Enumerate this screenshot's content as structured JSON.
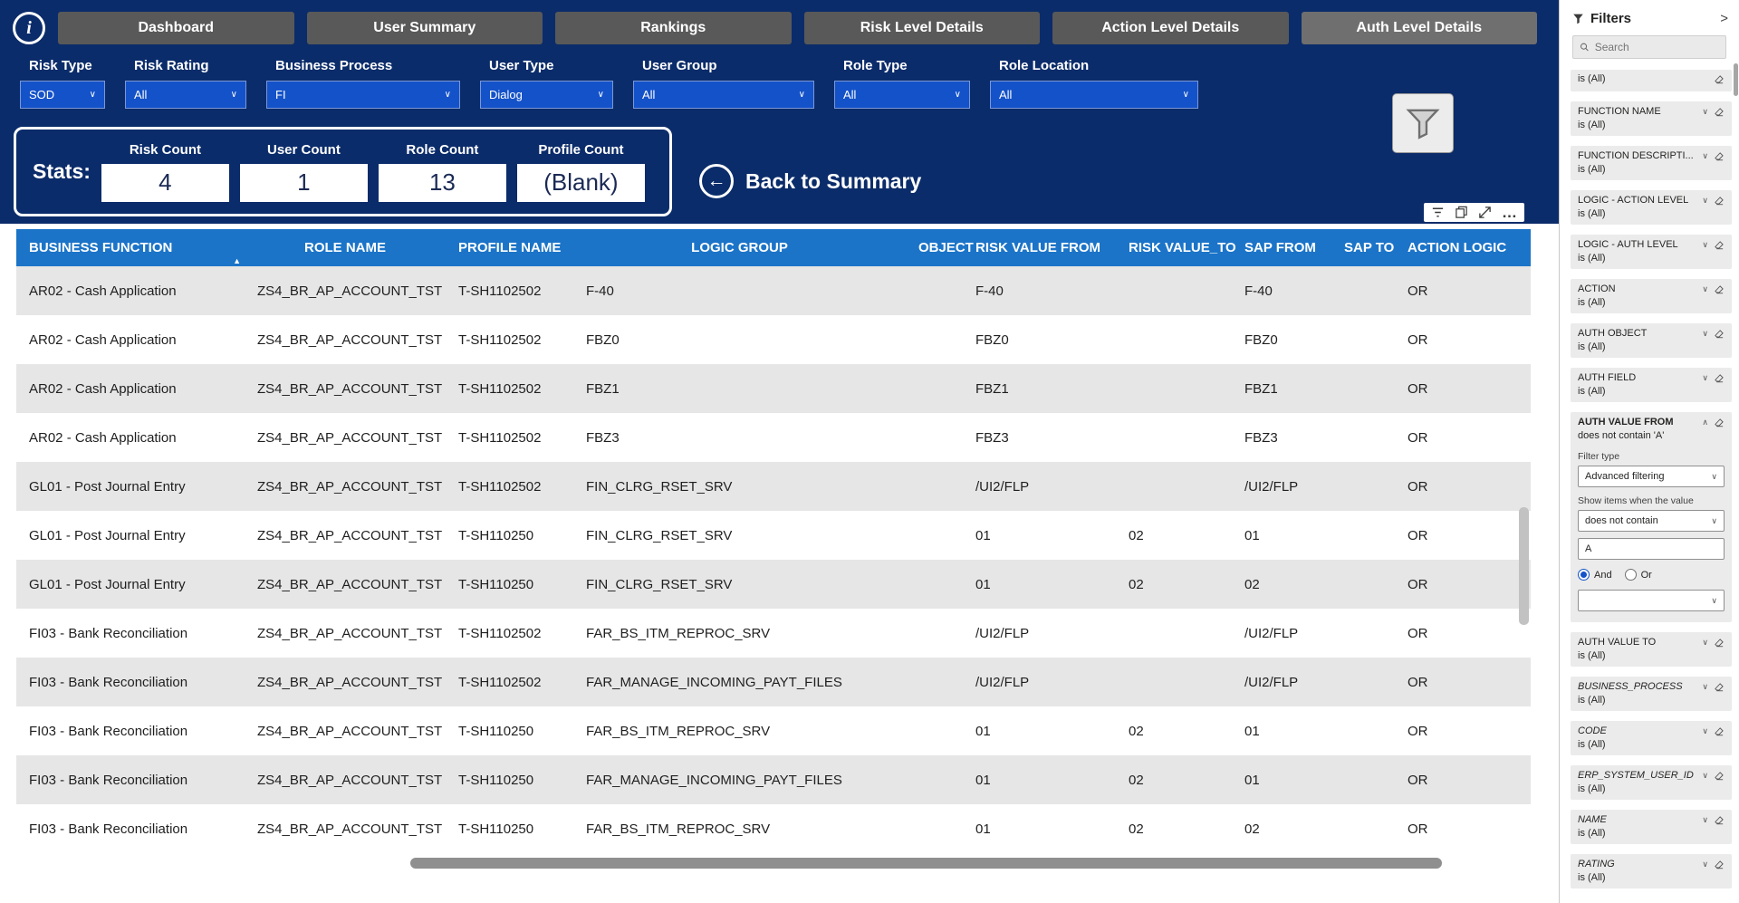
{
  "colors": {
    "navy_background": "#0b2c6a",
    "table_header_blue": "#1b74c8",
    "slicer_blue": "#1452c9",
    "nav_button_gray": "#595959",
    "active_nav_button_gray": "#6f6f6f",
    "row_alternate_gray": "#e6e6e6"
  },
  "icons": {
    "info": "i",
    "chevron_down": "∨",
    "chevron_up": "∧",
    "collapse_right": ">",
    "back_arrow": "←",
    "ellipsis": "…",
    "sort_ascending": "▲"
  },
  "nav": {
    "buttons": [
      "Dashboard",
      "User Summary",
      "Rankings",
      "Risk Level Details",
      "Action Level Details",
      "Auth Level Details"
    ]
  },
  "filter_bar": {
    "filters": [
      {
        "label": "Risk Type",
        "value": "SOD"
      },
      {
        "label": "Risk Rating",
        "value": "All"
      },
      {
        "label": "Business Process",
        "value": "FI"
      },
      {
        "label": "User Type",
        "value": "Dialog"
      },
      {
        "label": "User Group",
        "value": "All"
      },
      {
        "label": "Role Type",
        "value": "All"
      },
      {
        "label": "Role Location",
        "value": "All"
      }
    ]
  },
  "stats": {
    "label": "Stats:",
    "items": [
      {
        "label": "Risk Count",
        "value": "4"
      },
      {
        "label": "User Count",
        "value": "1"
      },
      {
        "label": "Role Count",
        "value": "13"
      },
      {
        "label": "Profile Count",
        "value": "(Blank)"
      }
    ],
    "back_label": "Back to Summary"
  },
  "table": {
    "columns": [
      "BUSINESS FUNCTION",
      "ROLE NAME",
      "PROFILE NAME",
      "LOGIC GROUP",
      "OBJECT",
      "RISK VALUE FROM",
      "RISK VALUE_TO",
      "SAP FROM",
      "SAP TO",
      "ACTION LOGIC"
    ],
    "rows": [
      [
        "AR02 - Cash Application",
        "ZS4_BR_AP_ACCOUNT_TST",
        "T-SH1102502",
        "F-40",
        "",
        "F-40",
        "",
        "F-40",
        "",
        "OR"
      ],
      [
        "AR02 - Cash Application",
        "ZS4_BR_AP_ACCOUNT_TST",
        "T-SH1102502",
        "FBZ0",
        "",
        "FBZ0",
        "",
        "FBZ0",
        "",
        "OR"
      ],
      [
        "AR02 - Cash Application",
        "ZS4_BR_AP_ACCOUNT_TST",
        "T-SH1102502",
        "FBZ1",
        "",
        "FBZ1",
        "",
        "FBZ1",
        "",
        "OR"
      ],
      [
        "AR02 - Cash Application",
        "ZS4_BR_AP_ACCOUNT_TST",
        "T-SH1102502",
        "FBZ3",
        "",
        "FBZ3",
        "",
        "FBZ3",
        "",
        "OR"
      ],
      [
        "GL01 - Post Journal Entry",
        "ZS4_BR_AP_ACCOUNT_TST",
        "T-SH1102502",
        "FIN_CLRG_RSET_SRV",
        "",
        "/UI2/FLP",
        "",
        "/UI2/FLP",
        "",
        "OR"
      ],
      [
        "GL01 - Post Journal Entry",
        "ZS4_BR_AP_ACCOUNT_TST",
        "T-SH110250",
        "FIN_CLRG_RSET_SRV",
        "",
        "01",
        "02",
        "01",
        "",
        "OR"
      ],
      [
        "GL01 - Post Journal Entry",
        "ZS4_BR_AP_ACCOUNT_TST",
        "T-SH110250",
        "FIN_CLRG_RSET_SRV",
        "",
        "01",
        "02",
        "02",
        "",
        "OR"
      ],
      [
        "FI03 - Bank Reconciliation",
        "ZS4_BR_AP_ACCOUNT_TST",
        "T-SH1102502",
        "FAR_BS_ITM_REPROC_SRV",
        "",
        "/UI2/FLP",
        "",
        "/UI2/FLP",
        "",
        "OR"
      ],
      [
        "FI03 - Bank Reconciliation",
        "ZS4_BR_AP_ACCOUNT_TST",
        "T-SH1102502",
        "FAR_MANAGE_INCOMING_PAYT_FILES",
        "",
        "/UI2/FLP",
        "",
        "/UI2/FLP",
        "",
        "OR"
      ],
      [
        "FI03 - Bank Reconciliation",
        "ZS4_BR_AP_ACCOUNT_TST",
        "T-SH110250",
        "FAR_BS_ITM_REPROC_SRV",
        "",
        "01",
        "02",
        "01",
        "",
        "OR"
      ],
      [
        "FI03 - Bank Reconciliation",
        "ZS4_BR_AP_ACCOUNT_TST",
        "T-SH110250",
        "FAR_MANAGE_INCOMING_PAYT_FILES",
        "",
        "01",
        "02",
        "01",
        "",
        "OR"
      ],
      [
        "FI03 - Bank Reconciliation",
        "ZS4_BR_AP_ACCOUNT_TST",
        "T-SH110250",
        "FAR_BS_ITM_REPROC_SRV",
        "",
        "01",
        "02",
        "02",
        "",
        "OR"
      ]
    ]
  },
  "filter_pane": {
    "title": "Filters",
    "search_placeholder": "Search",
    "partial_card": {
      "value": "is (All)"
    },
    "cards_top": [
      {
        "title": "FUNCTION NAME",
        "value": "is (All)"
      },
      {
        "title": "FUNCTION DESCRIPTI...",
        "value": "is (All)"
      },
      {
        "title": "LOGIC - ACTION LEVEL",
        "value": "is (All)"
      },
      {
        "title": "LOGIC - AUTH LEVEL",
        "value": "is (All)"
      },
      {
        "title": "ACTION",
        "value": "is (All)"
      },
      {
        "title": "AUTH OBJECT",
        "value": "is (All)"
      },
      {
        "title": "AUTH FIELD",
        "value": "is (All)"
      }
    ],
    "expanded_card": {
      "title": "AUTH VALUE FROM",
      "value": "does not contain 'A'",
      "filter_type_label": "Filter type",
      "filter_type_value": "Advanced filtering",
      "condition_label": "Show items when the value",
      "condition_value": "does not contain",
      "condition_input": "A",
      "and_label": "And",
      "or_label": "Or"
    },
    "card_auth_value_to": {
      "title": "AUTH VALUE TO",
      "value": "is (All)"
    },
    "cards_italic": [
      {
        "title": "BUSINESS_PROCESS",
        "value": "is (All)"
      },
      {
        "title": "CODE",
        "value": "is (All)"
      },
      {
        "title": "ERP_SYSTEM_USER_ID",
        "value": "is (All)"
      },
      {
        "title": "NAME",
        "value": "is (All)"
      },
      {
        "title": "RATING",
        "value": "is (All)"
      }
    ]
  }
}
